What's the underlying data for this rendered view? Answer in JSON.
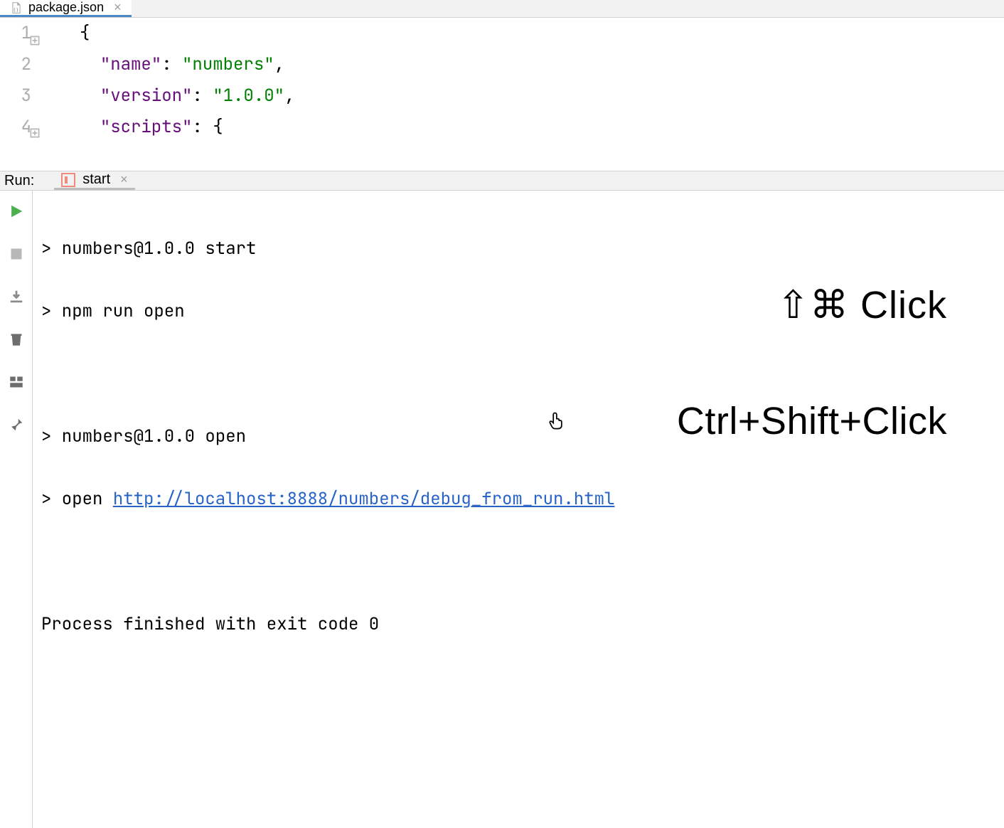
{
  "tab": {
    "filename": "package.json"
  },
  "editor": {
    "gutter": [
      "1",
      "2",
      "3",
      "4"
    ],
    "lines": [
      [
        [
          "punc",
          "{"
        ]
      ],
      [
        [
          "punc",
          "  "
        ],
        [
          "key",
          "\"name\""
        ],
        [
          "punc",
          ": "
        ],
        [
          "str",
          "\"numbers\""
        ],
        [
          "punc",
          ","
        ]
      ],
      [
        [
          "punc",
          "  "
        ],
        [
          "key",
          "\"version\""
        ],
        [
          "punc",
          ": "
        ],
        [
          "str",
          "\"1.0.0\""
        ],
        [
          "punc",
          ","
        ]
      ],
      [
        [
          "punc",
          "  "
        ],
        [
          "key",
          "\"scripts\""
        ],
        [
          "punc",
          ": {"
        ]
      ]
    ]
  },
  "run": {
    "panel_label": "Run:",
    "tab_name": "start",
    "console_lines": [
      "> numbers@1.0.0 start",
      "> npm run open",
      "",
      "",
      "> numbers@1.0.0 open"
    ],
    "open_prefix": "> open ",
    "open_url": "http://localhost:8888/numbers/debug_from_run.html",
    "blank": "",
    "exit_line": "Process finished with exit code 0"
  },
  "hint": {
    "line1": "⇧⌘ Click",
    "line2": "Ctrl+Shift+Click"
  }
}
